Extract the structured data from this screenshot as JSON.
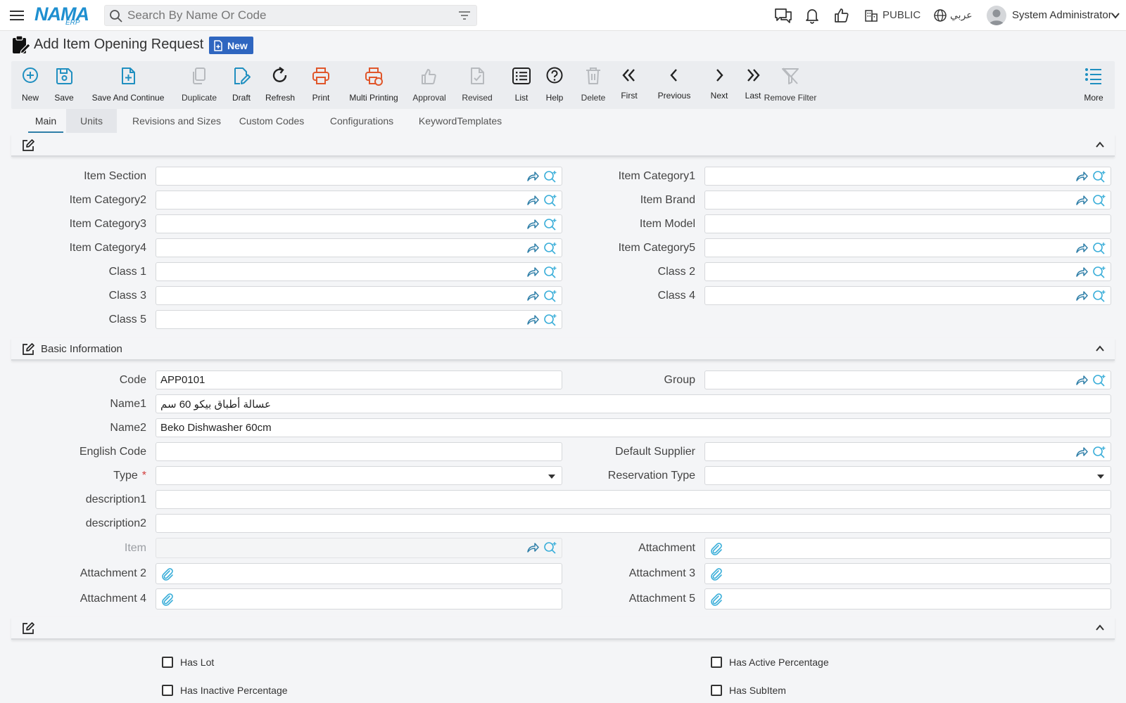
{
  "topbar": {
    "logo_main": "NAMA",
    "logo_sub": "ERP",
    "search_placeholder": "Search By Name Or Code",
    "branch": "PUBLIC",
    "language": "عربي",
    "user_name": "System Administrator"
  },
  "page": {
    "title": "Add Item Opening Request",
    "status": "New"
  },
  "toolbar": [
    {
      "label": "New",
      "icon": "plus-circle-icon",
      "color": "#1f8fc0"
    },
    {
      "label": "Save",
      "icon": "save-icon",
      "color": "#1f8fc0"
    },
    {
      "label": "Save And Continue",
      "icon": "save-continue-icon",
      "color": "#1f8fc0"
    },
    {
      "label": "Duplicate",
      "icon": "duplicate-icon",
      "color": "#b7babe"
    },
    {
      "label": "Draft",
      "icon": "draft-icon",
      "color": "#1f8fc0"
    },
    {
      "label": "Refresh",
      "icon": "refresh-icon",
      "color": "#222222"
    },
    {
      "label": "Print",
      "icon": "printer-icon",
      "color": "#e0562a"
    },
    {
      "label": "Multi Printing",
      "icon": "multi-printer-icon",
      "color": "#e0562a"
    },
    {
      "label": "Approval",
      "icon": "thumbs-up-icon",
      "color": "#b7babe"
    },
    {
      "label": "Revised",
      "icon": "revised-icon",
      "color": "#b7babe"
    },
    {
      "label": "List",
      "icon": "list-icon",
      "color": "#222222"
    },
    {
      "label": "Help",
      "icon": "help-icon",
      "color": "#222222"
    },
    {
      "label": "Delete",
      "icon": "trash-icon",
      "color": "#b7babe"
    },
    {
      "label": "First",
      "icon": "first-icon",
      "color": "#222222"
    },
    {
      "label": "Previous",
      "icon": "previous-icon",
      "color": "#222222"
    },
    {
      "label": "Next",
      "icon": "next-icon",
      "color": "#222222"
    },
    {
      "label": "Last",
      "icon": "last-icon",
      "color": "#222222"
    },
    {
      "label": "Remove Filter",
      "icon": "remove-filter-icon",
      "color": "#b7babe"
    },
    {
      "label": "More",
      "icon": "more-list-icon",
      "color": "#1f8fc0"
    }
  ],
  "tabs": [
    "Main",
    "Units",
    "Revisions and Sizes",
    "Custom Codes",
    "Configurations",
    "KeywordTemplates"
  ],
  "sections": {
    "classification_title": "",
    "basic_title": "Basic Information",
    "flags_title": ""
  },
  "classification": {
    "item_section": "Item Section",
    "item_category1": "Item Category1",
    "item_category2": "Item Category2",
    "item_brand": "Item Brand",
    "item_category3": "Item Category3",
    "item_model": "Item Model",
    "item_category4": "Item Category4",
    "item_category5": "Item Category5",
    "class1": "Class 1",
    "class2": "Class 2",
    "class3": "Class 3",
    "class4": "Class 4",
    "class5": "Class 5"
  },
  "basic": {
    "code_label": "Code",
    "code_value": "APP0101",
    "group_label": "Group",
    "name1_label": "Name1",
    "name1_value": "عسالة أطباق بيكو 60 سم",
    "name2_label": "Name2",
    "name2_value": "Beko Dishwasher 60cm",
    "english_code_label": "English Code",
    "default_supplier_label": "Default Supplier",
    "type_label": "Type",
    "type_required": "*",
    "reservation_type_label": "Reservation Type",
    "description1_label": "description1",
    "description2_label": "description2",
    "item_label": "Item",
    "attachment_label": "Attachment",
    "attachment2_label": "Attachment 2",
    "attachment3_label": "Attachment 3",
    "attachment4_label": "Attachment 4",
    "attachment5_label": "Attachment 5"
  },
  "flags": {
    "has_lot": "Has Lot",
    "has_active_percentage": "Has Active Percentage",
    "has_inactive_percentage": "Has Inactive Percentage",
    "has_subitem": "Has SubItem"
  },
  "colors": {
    "accent": "#1f8fc0",
    "brand": "#1e8fd0",
    "badge": "#2f66c0",
    "print": "#e0562a",
    "disabled": "#b7babe",
    "required": "#d23c3c"
  }
}
